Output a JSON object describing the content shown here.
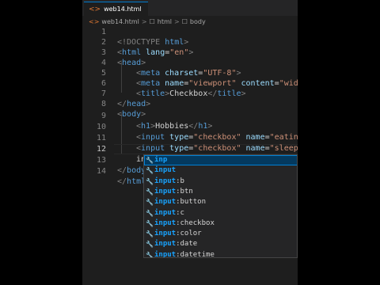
{
  "tab": {
    "icon": "<>",
    "label": "web14.html"
  },
  "breadcrumb": {
    "file_icon": "<>",
    "file": "web14.html",
    "sep": ">",
    "el_icon": "☐",
    "html": "html",
    "body": "body"
  },
  "editor": {
    "lines": [
      {
        "n": "1"
      },
      {
        "n": "2"
      },
      {
        "n": "3"
      },
      {
        "n": "4"
      },
      {
        "n": "5"
      },
      {
        "n": "6"
      },
      {
        "n": "7"
      },
      {
        "n": "8"
      },
      {
        "n": "9"
      },
      {
        "n": "10"
      },
      {
        "n": "11"
      },
      {
        "n": "12"
      },
      {
        "n": "13"
      },
      {
        "n": "14"
      }
    ],
    "tokens": {
      "l1a": "<!DOCTYPE",
      "l1b": " html",
      "l1c": ">",
      "l2a": "<",
      "l2b": "html",
      "l2c": " lang",
      "l2d": "=",
      "l2e": "\"en\"",
      "l2f": ">",
      "l3a": "<",
      "l3b": "head",
      "l3c": ">",
      "l4a": "<",
      "l4b": "meta",
      "l4c": " charset",
      "l4d": "=",
      "l4e": "\"UTF-8\"",
      "l4f": ">",
      "l5a": "<",
      "l5b": "meta",
      "l5c": " name",
      "l5d": "=",
      "l5e": "\"viewport\"",
      "l5f": " content",
      "l5g": "=",
      "l5h": "\"width=d",
      "l6a": "<",
      "l6b": "title",
      "l6c": ">",
      "l6d": "Checkbox",
      "l6e": "</",
      "l6f": "title",
      "l6g": ">",
      "l7a": "</",
      "l7b": "head",
      "l7c": ">",
      "l8a": "<",
      "l8b": "body",
      "l8c": ">",
      "l9a": "<",
      "l9b": "h1",
      "l9c": ">",
      "l9d": "Hobbies",
      "l9e": "</",
      "l9f": "h1",
      "l9g": ">",
      "l10a": "<",
      "l10b": "input",
      "l10c": " type",
      "l10d": "=",
      "l10e": "\"checkbox\"",
      "l10f": " name",
      "l10g": "=",
      "l10h": "\"eating\"",
      "l11a": "<",
      "l11b": "input",
      "l11c": " type",
      "l11d": "=",
      "l11e": "\"checkbox\"",
      "l11f": " name",
      "l11g": "=",
      "l11h": "\"sleeping\"",
      "l12a": "in",
      "l13a": "</",
      "l13b": "body",
      "l14a": "</",
      "l14b": "html"
    }
  },
  "suggestions": [
    {
      "icon": "🔧",
      "match": "inp",
      "rest": ""
    },
    {
      "icon": "🔧",
      "match": "input",
      "rest": ""
    },
    {
      "icon": "🔧",
      "match": "input",
      "rest": ":b"
    },
    {
      "icon": "🔧",
      "match": "input",
      "rest": ":btn"
    },
    {
      "icon": "🔧",
      "match": "input",
      "rest": ":button"
    },
    {
      "icon": "🔧",
      "match": "input",
      "rest": ":c"
    },
    {
      "icon": "🔧",
      "match": "input",
      "rest": ":checkbox"
    },
    {
      "icon": "🔧",
      "match": "input",
      "rest": ":color"
    },
    {
      "icon": "🔧",
      "match": "input",
      "rest": ":date"
    },
    {
      "icon": "🔧",
      "match": "input",
      "rest": ":datetime"
    }
  ]
}
